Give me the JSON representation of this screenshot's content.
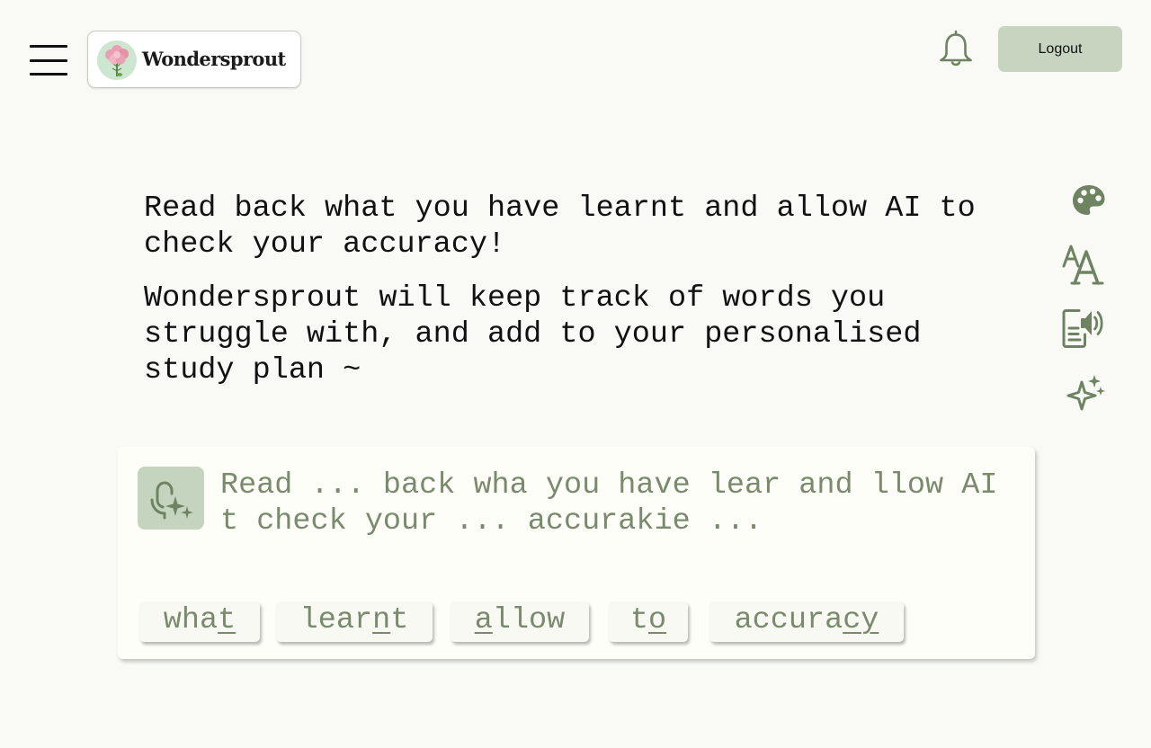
{
  "header": {
    "brand": "Wondersprout",
    "logout_label": "Logout",
    "menu_icon": "hamburger-menu-icon",
    "notification_icon": "bell-icon"
  },
  "intro": {
    "line1": "Read back what you have learnt and allow AI to check your accuracy!",
    "line2": "Wondersprout will keep track of words you struggle with, and add to your personalised study plan ~"
  },
  "side_toolbar": [
    {
      "icon": "palette-icon"
    },
    {
      "icon": "text-size-icon"
    },
    {
      "icon": "read-aloud-icon"
    },
    {
      "icon": "sparkles-icon"
    }
  ],
  "reading": {
    "mic_icon": "microphone-sparkle-icon",
    "transcript": "Read ... back wha you have lear and llow AI t check your ... accurakie ...",
    "words": [
      {
        "pre": "wha",
        "u": "t",
        "post": ""
      },
      {
        "pre": "lear",
        "u": "n",
        "post": "t"
      },
      {
        "pre": "",
        "u": "a",
        "post": "llow"
      },
      {
        "pre": "t",
        "u": "o",
        "post": ""
      },
      {
        "pre": "accura",
        "u": "cy",
        "post": ""
      }
    ]
  },
  "colors": {
    "background": "#f9faf5",
    "accent": "#c7d5c0",
    "icon": "#6e8362",
    "transcript_text": "#7a8a6d"
  }
}
